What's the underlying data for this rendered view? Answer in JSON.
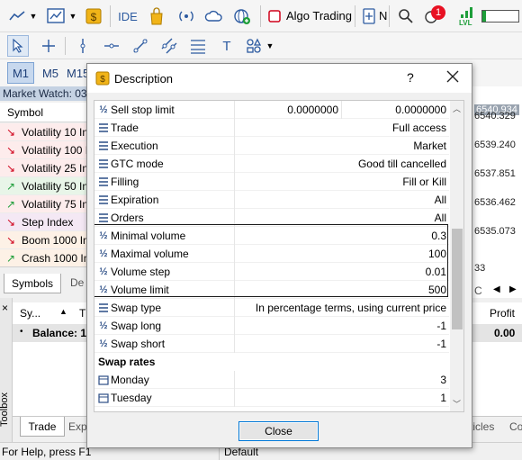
{
  "toolbar": {
    "ide_label": "IDE",
    "algo_trading_label": "Algo Trading",
    "algo_trading_cut": "N",
    "notification_count": "1",
    "lvl_label": "LVL"
  },
  "timeframes": [
    "M1",
    "M5",
    "M15"
  ],
  "market_watch": {
    "title": "Market Watch: 03:",
    "column_symbol": "Symbol",
    "rows": [
      {
        "arrow": "↘",
        "dir": "down",
        "label": "Volatility 10 In"
      },
      {
        "arrow": "↘",
        "dir": "down",
        "label": "Volatility 100 I"
      },
      {
        "arrow": "↘",
        "dir": "down",
        "label": "Volatility 25 In"
      },
      {
        "arrow": "↗",
        "dir": "up",
        "label": "Volatility 50 In"
      },
      {
        "arrow": "↗",
        "dir": "up",
        "label": "Volatility 75 In"
      },
      {
        "arrow": "↘",
        "dir": "down",
        "label": "Step Index"
      },
      {
        "arrow": "↘",
        "dir": "down",
        "label": "Boom 1000 In"
      },
      {
        "arrow": "↗",
        "dir": "up",
        "label": "Crash 1000 In"
      }
    ],
    "tab_symbols": "Symbols",
    "tab_details": "De"
  },
  "chart_prices": [
    "6540.934",
    "6540.329",
    "6539.240",
    "6537.851",
    "6536.462",
    "6535.073",
    "33"
  ],
  "dialog": {
    "title": "Description",
    "help": "?",
    "close_button": "Close",
    "rows": [
      {
        "icon": "fraction",
        "name": "Sell stop limit",
        "val1": "0.0000000",
        "val2": "0.0000000"
      },
      {
        "icon": "list",
        "name": "Trade",
        "value": "Full access"
      },
      {
        "icon": "list",
        "name": "Execution",
        "value": "Market"
      },
      {
        "icon": "list",
        "name": "GTC mode",
        "value": "Good till cancelled"
      },
      {
        "icon": "list",
        "name": "Filling",
        "value": "Fill or Kill"
      },
      {
        "icon": "list",
        "name": "Expiration",
        "value": "All"
      },
      {
        "icon": "list",
        "name": "Orders",
        "value": "All"
      },
      {
        "icon": "fraction",
        "name": "Minimal volume",
        "value": "0.3"
      },
      {
        "icon": "fraction",
        "name": "Maximal volume",
        "value": "100"
      },
      {
        "icon": "fraction",
        "name": "Volume step",
        "value": "0.01"
      },
      {
        "icon": "fraction",
        "name": "Volume limit",
        "value": "500"
      },
      {
        "icon": "list",
        "name": "Swap type",
        "value": "In percentage terms, using current price"
      },
      {
        "icon": "fraction",
        "name": "Swap long",
        "value": "-1"
      },
      {
        "icon": "fraction",
        "name": "Swap short",
        "value": "-1"
      },
      {
        "group": "Swap rates"
      },
      {
        "icon": "calendar",
        "name": "Monday",
        "value": "3"
      },
      {
        "icon": "calendar",
        "name": "Tuesday",
        "value": "1"
      }
    ]
  },
  "terminal": {
    "col_symbol": "Sy...",
    "col_t": "T",
    "col_profit": "Profit",
    "balance_label": "Balance: 10",
    "balance_profit": "0.00",
    "tab_trade": "Trade",
    "tab_exp": "Exp",
    "tab_articles": "ticles",
    "tab_co": "Co",
    "tab_c": "C",
    "toolbox": "Toolbox"
  },
  "status": {
    "help": "For Help, press F1",
    "profile": "Default"
  },
  "colors": {
    "accent": "#0078d7",
    "down": "#d0021b",
    "up": "#1e9e3a",
    "badge": "#e81123"
  }
}
